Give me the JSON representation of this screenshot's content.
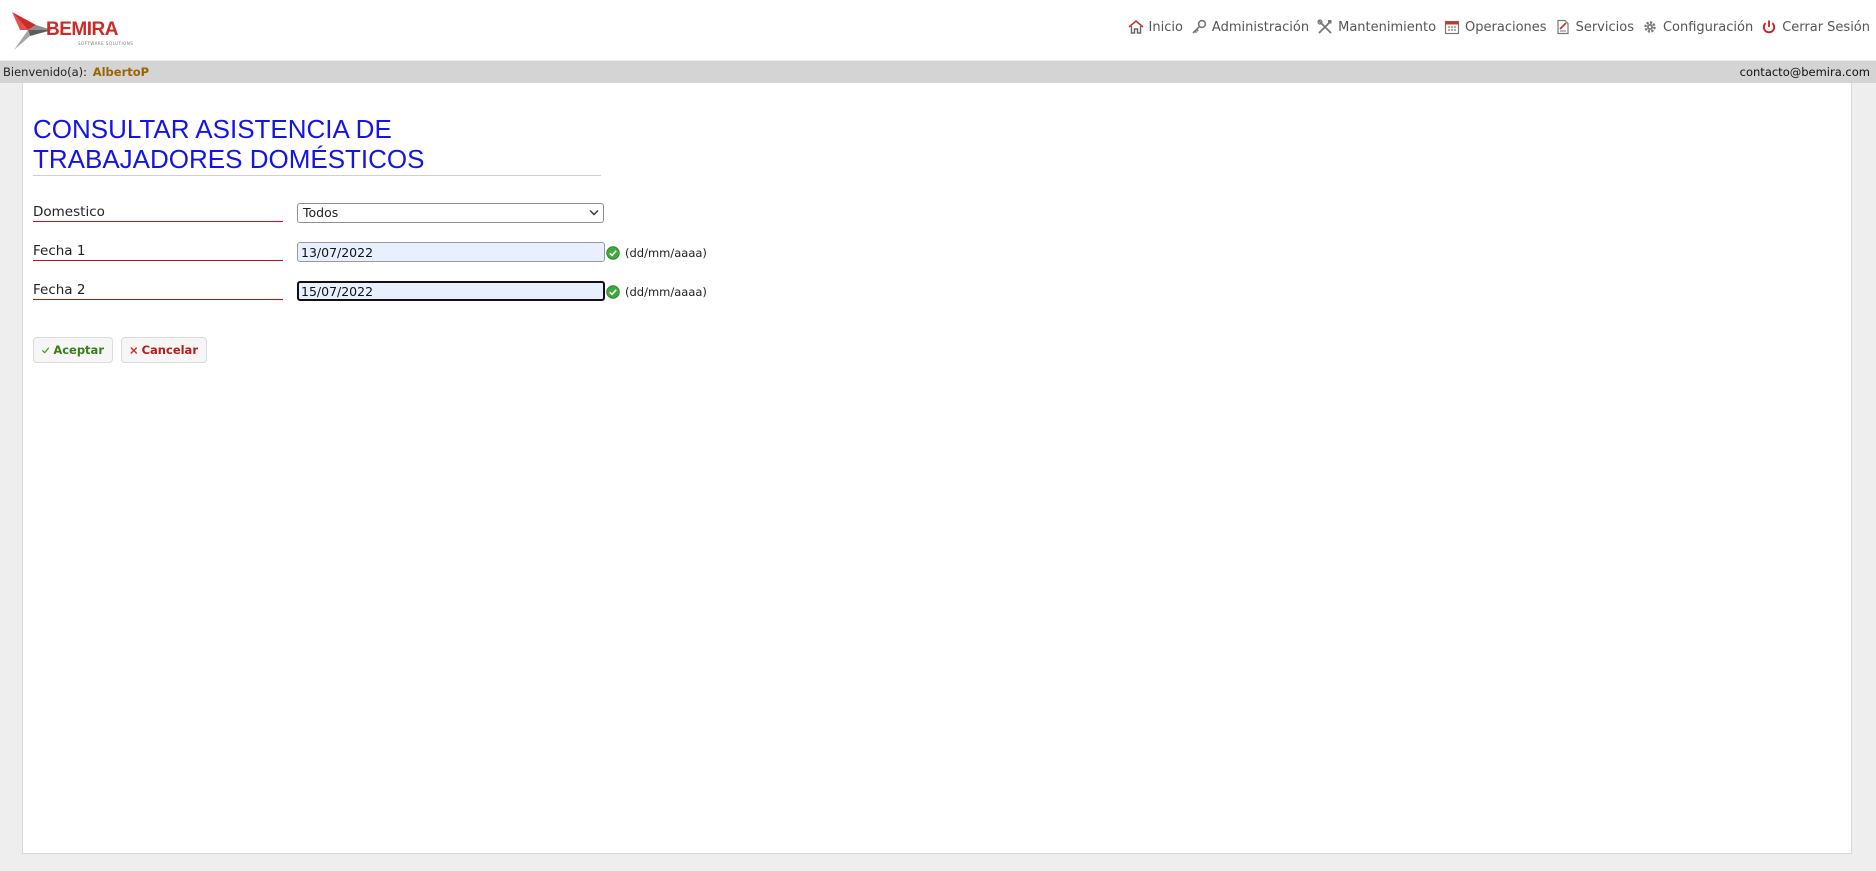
{
  "brand": {
    "name": "BEMIRA",
    "tagline": "SOFTWARE SOLUTIONS",
    "accent_color": "#cf2a27"
  },
  "nav": {
    "items": [
      {
        "label": "Inicio",
        "icon": "home-icon"
      },
      {
        "label": "Administración",
        "icon": "key-icon"
      },
      {
        "label": "Mantenimiento",
        "icon": "tools-icon"
      },
      {
        "label": "Operaciones",
        "icon": "calendar-icon"
      },
      {
        "label": "Servicios",
        "icon": "document-icon"
      },
      {
        "label": "Configuración",
        "icon": "gear-icon"
      },
      {
        "label": "Cerrar Sesión",
        "icon": "power-icon"
      }
    ]
  },
  "welcome": {
    "prefix": "Bienvenido(a):",
    "username": "AlbertoP",
    "contact": "contacto@bemira.com"
  },
  "page": {
    "title_line1": "CONSULTAR ASISTENCIA DE",
    "title_line2": "TRABAJADORES DOMÉSTICOS",
    "title_color": "#1414e6"
  },
  "form": {
    "domestico": {
      "label": "Domestico",
      "selected": "Todos"
    },
    "fecha1": {
      "label": "Fecha 1",
      "value": "13/07/2022",
      "hint": "(dd/mm/aaaa)"
    },
    "fecha2": {
      "label": "Fecha 2",
      "value": "15/07/2022",
      "hint": "(dd/mm/aaaa)"
    }
  },
  "buttons": {
    "accept": "Aceptar",
    "cancel": "Cancelar"
  }
}
